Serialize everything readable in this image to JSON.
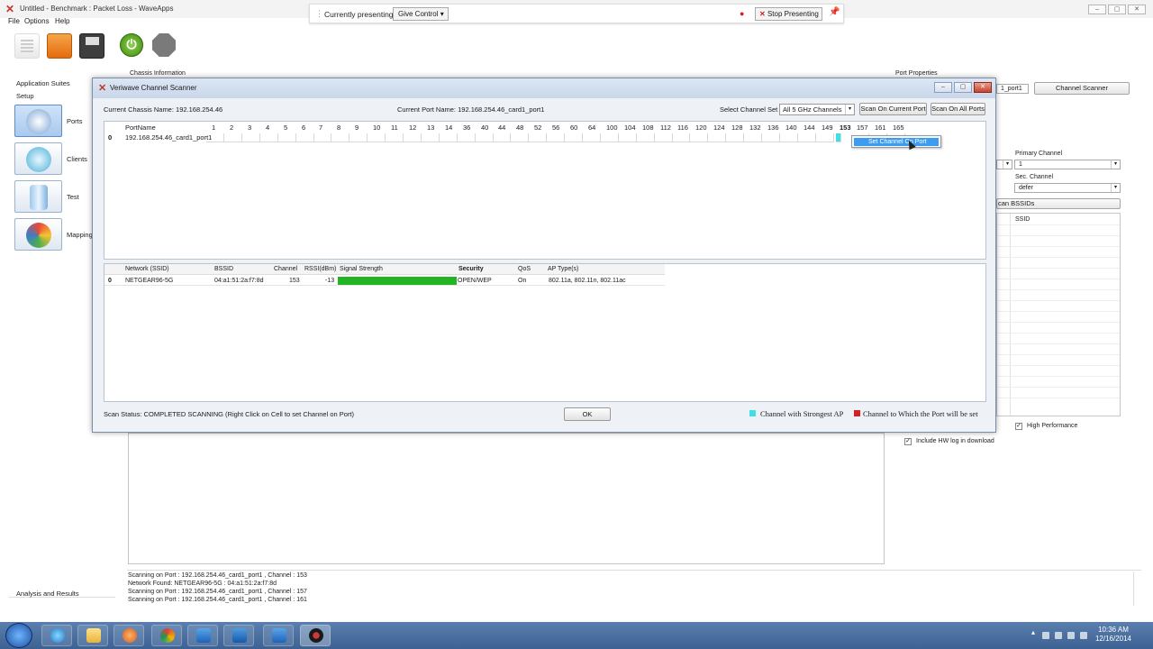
{
  "window": {
    "title": "Untitled - Benchmark : Packet Loss - WaveApps",
    "menu": [
      "File",
      "Options",
      "Help"
    ]
  },
  "presenting": {
    "status": "Currently presenting",
    "give_control": "Give Control",
    "stop": "Stop Presenting"
  },
  "left_panel": {
    "app_suites": "Application Suites",
    "setup": "Setup",
    "items": [
      "Ports",
      "Clients",
      "Test",
      "Mapping"
    ],
    "analysis": "Analysis and Results"
  },
  "background": {
    "chassis_info": "Chassis Information",
    "port_properties": "Port Properties",
    "port_field": "1_port1",
    "channel_scanner_btn": "Channel Scanner",
    "primary_channel_label": "Primary Channel",
    "primary_channel_value": "1",
    "sec_channel_label": "Sec. Channel",
    "sec_channel_value": "defer",
    "scan_bssids": "can BSSIDs",
    "ssid_header": "SSID",
    "high_performance": "High Performance",
    "include_hw_log": "Include HW log in download"
  },
  "dialog": {
    "title": "Veriwave Channel Scanner",
    "chassis_name": "Current Chassis Name: 192.168.254.46",
    "port_name": "Current Port Name: 192.168.254.46_card1_port1",
    "select_channel_set": "Select Channel Set",
    "channel_set_value": "All 5 GHz Channels",
    "scan_current": "Scan On Current Port",
    "scan_all": "Scan On All Ports",
    "port_column": "PortName",
    "channels": [
      "1",
      "2",
      "3",
      "4",
      "5",
      "6",
      "7",
      "8",
      "9",
      "10",
      "11",
      "12",
      "13",
      "14",
      "36",
      "40",
      "44",
      "48",
      "52",
      "56",
      "60",
      "64",
      "100",
      "104",
      "108",
      "112",
      "116",
      "120",
      "124",
      "128",
      "132",
      "136",
      "140",
      "144",
      "149",
      "153",
      "157",
      "161",
      "165"
    ],
    "highlighted_channel": "153",
    "rows": [
      {
        "index": "0",
        "port": "192.168.254.46_card1_port1"
      }
    ],
    "context_menu_item": "Set Channel On Port",
    "networks": {
      "headers": [
        "Network (SSID)",
        "BSSID",
        "Channel",
        "RSSI(dBm)",
        "Signal Strength",
        "Security",
        "QoS",
        "AP Type(s)"
      ],
      "rows": [
        {
          "index": "0",
          "ssid": "NETGEAR96-5G",
          "bssid": "04:a1:51:2a:f7:8d",
          "channel": "153",
          "rssi": "-13",
          "signal_fraction": 1.0,
          "security": "OPEN/WEP",
          "qos": "On",
          "ap_types": "802.11a, 802.11n, 802.11ac"
        }
      ]
    },
    "scan_status": "Scan Status: COMPLETED SCANNING (Right Click on Cell to set Channel on Port)",
    "ok": "OK",
    "legend": [
      {
        "label": "Channel with Strongest AP",
        "color": "#3ee0e8"
      },
      {
        "label": "Channel to Which the Port will be set",
        "color": "#d42020"
      }
    ]
  },
  "log": [
    "Scanning on Port : 192.168.254.46_card1_port1 , Channel : 153",
    "Network Found: NETGEAR96-5G : 04:a1:51:2a:f7:8d",
    "Scanning on Port : 192.168.254.46_card1_port1 , Channel : 157",
    "Scanning on Port : 192.168.254.46_card1_port1 , Channel : 161"
  ],
  "taskbar": {
    "time": "10:36 AM",
    "date": "12/16/2014"
  },
  "colors": {
    "signal_bar": "#22b422",
    "strongest_ap": "#3ee0e8",
    "selected_channel": "#d42020"
  }
}
